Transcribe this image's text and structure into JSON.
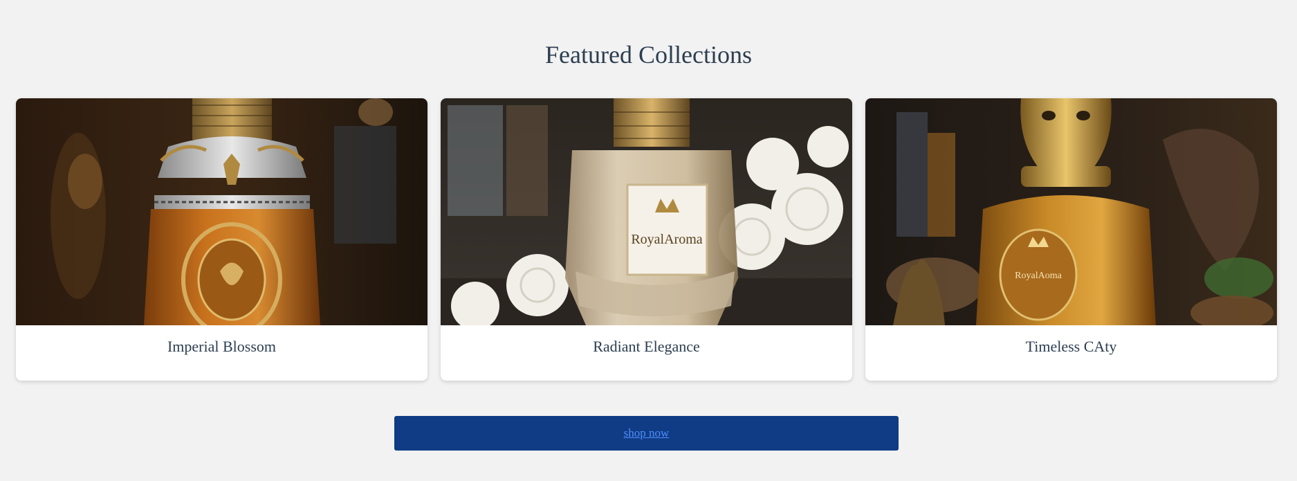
{
  "section": {
    "title": "Featured Collections"
  },
  "collections": [
    {
      "name": "Imperial Blossom",
      "image": "amber-perfume-bottle-ornate-gold-cap"
    },
    {
      "name": "Radiant Elegance",
      "image": "clear-perfume-bottle-crown-cap-white-roses",
      "label_brand": "RoyalAroma"
    },
    {
      "name": "Timeless CAty",
      "image": "gold-perfume-bottle-panther-cap",
      "label_brand": "RoyalAoma"
    }
  ],
  "cta": {
    "label": "shop now"
  },
  "colors": {
    "background": "#f2f2f2",
    "title": "#2c3e50",
    "button_bg": "#0f3c84",
    "button_link": "#4f8dff"
  }
}
